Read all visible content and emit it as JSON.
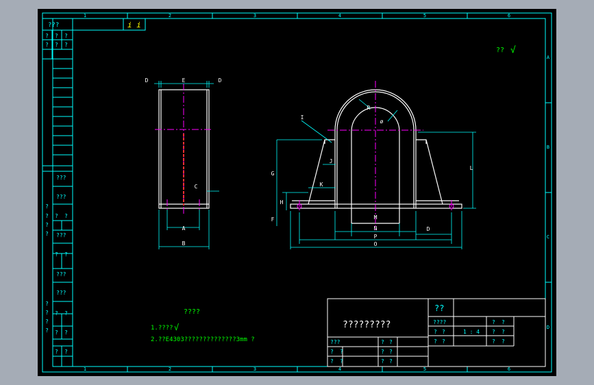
{
  "colors": {
    "background_outer": "#a5acb6",
    "sheet": "#000000",
    "frame": "#00ffff",
    "geometry": "#ffffff",
    "dimension": "#00ffff",
    "centerline": "#ff00ff",
    "hidden": "#ff3030",
    "notes": "#00ff00",
    "tags": "#ffff00"
  },
  "border": {
    "top_zones": [
      "1",
      "2",
      "3",
      "4",
      "5",
      "6"
    ],
    "bottom_zones": [
      "1",
      "2",
      "3",
      "4",
      "5",
      "6"
    ],
    "right_zones": [
      "A",
      "B",
      "C",
      "D"
    ]
  },
  "top_left_block": {
    "code": "???",
    "marks": "i  i"
  },
  "left_strip": {
    "upper_cells": [
      "?",
      "?",
      "?",
      "?",
      "?",
      "?"
    ],
    "lower_labels": [
      "???",
      "???",
      "???",
      "???",
      "???",
      "???",
      "???",
      "???"
    ],
    "lower_cells": [
      "?",
      "?",
      "?",
      "?",
      "?",
      "?",
      "?",
      "?",
      "?",
      "?",
      "?",
      "?"
    ]
  },
  "roughness_note": {
    "text": "??",
    "symbol": "√"
  },
  "dimension_labels": {
    "left_top": [
      "D",
      "E",
      "D"
    ],
    "left_C": "C",
    "left_A": "A",
    "left_B": "B",
    "right_I": "I",
    "right_J": "J",
    "right_K": "K",
    "right_G": "G",
    "right_H": "H",
    "right_F": "F",
    "right_L": "L",
    "right_M": "M",
    "right_N": "N",
    "right_P": "P",
    "right_O": "O",
    "right_D": "D",
    "right_R1": "R",
    "right_R2": "ø"
  },
  "tech_requirements": {
    "title": "????",
    "line1": "1.????",
    "line2": "2.??E4303??????????????3mm  ?"
  },
  "title_block": {
    "drawing_name": "?????????",
    "company": "??",
    "scale_label": "????",
    "scale_value": "1 : 4",
    "cells_right": [
      "?",
      "?",
      "?",
      "?",
      "?",
      "?",
      "?",
      "?",
      "?",
      "?"
    ],
    "sign_label": "???",
    "sign_cells": [
      "?",
      "?",
      "?",
      "?",
      "?",
      "?",
      "?",
      "?",
      "?",
      "?",
      "?"
    ]
  }
}
